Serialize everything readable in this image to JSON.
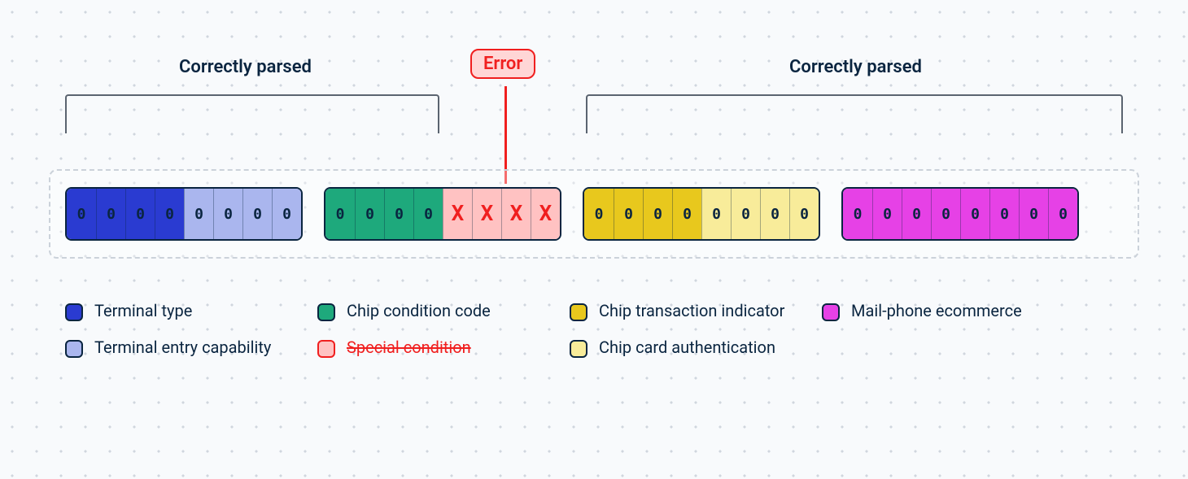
{
  "labels": {
    "left": "Correctly parsed",
    "error": "Error",
    "right": "Correctly parsed"
  },
  "groups": [
    {
      "id": "g1",
      "cells": [
        {
          "v": "0",
          "colorKey": "darkblue"
        },
        {
          "v": "0",
          "colorKey": "darkblue"
        },
        {
          "v": "0",
          "colorKey": "darkblue"
        },
        {
          "v": "0",
          "colorKey": "darkblue"
        },
        {
          "v": "0",
          "colorKey": "lightblue"
        },
        {
          "v": "0",
          "colorKey": "lightblue"
        },
        {
          "v": "0",
          "colorKey": "lightblue"
        },
        {
          "v": "0",
          "colorKey": "lightblue"
        }
      ]
    },
    {
      "id": "g2",
      "cells": [
        {
          "v": "0",
          "colorKey": "green"
        },
        {
          "v": "0",
          "colorKey": "green"
        },
        {
          "v": "0",
          "colorKey": "green"
        },
        {
          "v": "0",
          "colorKey": "green"
        },
        {
          "v": "X",
          "colorKey": "red",
          "err": true
        },
        {
          "v": "X",
          "colorKey": "red",
          "err": true
        },
        {
          "v": "X",
          "colorKey": "red",
          "err": true
        },
        {
          "v": "X",
          "colorKey": "red",
          "err": true
        }
      ]
    },
    {
      "id": "g3",
      "cells": [
        {
          "v": "0",
          "colorKey": "yellow"
        },
        {
          "v": "0",
          "colorKey": "yellow"
        },
        {
          "v": "0",
          "colorKey": "yellow"
        },
        {
          "v": "0",
          "colorKey": "yellow"
        },
        {
          "v": "0",
          "colorKey": "paleyellow"
        },
        {
          "v": "0",
          "colorKey": "paleyellow"
        },
        {
          "v": "0",
          "colorKey": "paleyellow"
        },
        {
          "v": "0",
          "colorKey": "paleyellow"
        }
      ]
    },
    {
      "id": "g4",
      "cells": [
        {
          "v": "0",
          "colorKey": "magenta"
        },
        {
          "v": "0",
          "colorKey": "magenta"
        },
        {
          "v": "0",
          "colorKey": "magenta"
        },
        {
          "v": "0",
          "colorKey": "magenta"
        },
        {
          "v": "0",
          "colorKey": "magenta"
        },
        {
          "v": "0",
          "colorKey": "magenta"
        },
        {
          "v": "0",
          "colorKey": "magenta"
        },
        {
          "v": "0",
          "colorKey": "magenta"
        }
      ]
    }
  ],
  "colors": {
    "darkblue": "#2a3bd1",
    "lightblue": "#aab6ee",
    "green": "#1ea97c",
    "red": "#ffc2c2",
    "yellow": "#e8c81d",
    "paleyellow": "#f8ec9a",
    "magenta": "#e641e6"
  },
  "legend": {
    "col1": [
      {
        "colorKey": "darkblue",
        "label": "Terminal type"
      },
      {
        "colorKey": "lightblue",
        "label": "Terminal entry capability"
      }
    ],
    "col2": [
      {
        "colorKey": "green",
        "label": "Chip condition code"
      },
      {
        "colorKey": "red",
        "label": "Special condition",
        "strike": true,
        "border": "#f01f1f"
      }
    ],
    "col3": [
      {
        "colorKey": "yellow",
        "label": "Chip transaction indicator"
      },
      {
        "colorKey": "paleyellow",
        "label": "Chip card authentication"
      }
    ],
    "col4": [
      {
        "colorKey": "magenta",
        "label": "Mail-phone ecommerce"
      }
    ]
  }
}
